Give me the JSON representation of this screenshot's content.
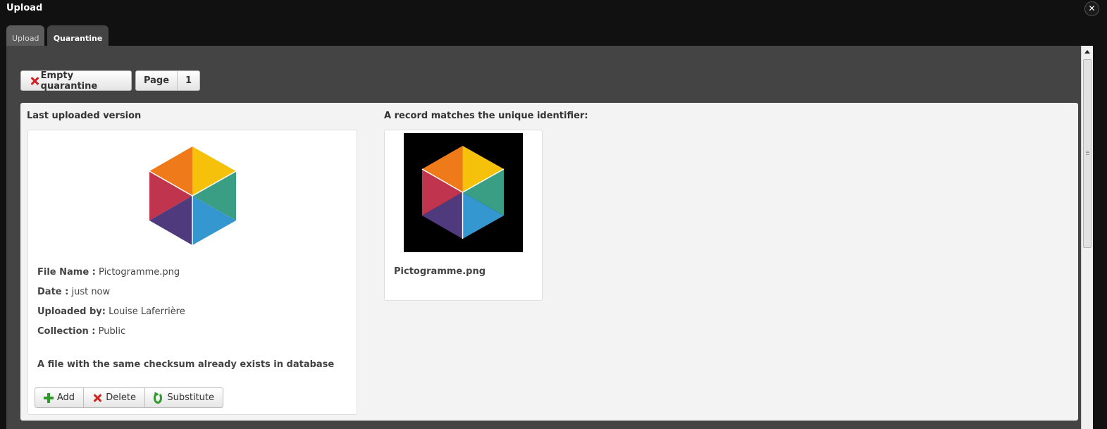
{
  "window": {
    "title": "Upload",
    "close_icon": "close-icon"
  },
  "tabs": [
    {
      "label": "Upload",
      "active": false
    },
    {
      "label": "Quarantine",
      "active": true
    }
  ],
  "toolbar": {
    "empty_label": "Empty quarantine",
    "page_label": "Page",
    "page_number": "1"
  },
  "left": {
    "heading": "Last uploaded version",
    "file_name_label": "File Name :",
    "file_name": "Pictogramme.png",
    "date_label": "Date :",
    "date": "just now",
    "uploaded_by_label": "Uploaded by:",
    "uploaded_by": "Louise Laferrière",
    "collection_label": "Collection :",
    "collection": "Public",
    "warning": "A file with the same checksum already exists in database",
    "actions": {
      "add": "Add",
      "delete": "Delete",
      "substitute": "Substitute"
    }
  },
  "right": {
    "heading": "A record matches the unique identifier:",
    "file_name": "Pictogramme.png"
  },
  "colors": {
    "window_bg": "#111111",
    "panel_bg": "#444444",
    "content_bg": "#f3f3f3",
    "delete_red": "#d21f1f",
    "add_green": "#2f9a2b"
  }
}
